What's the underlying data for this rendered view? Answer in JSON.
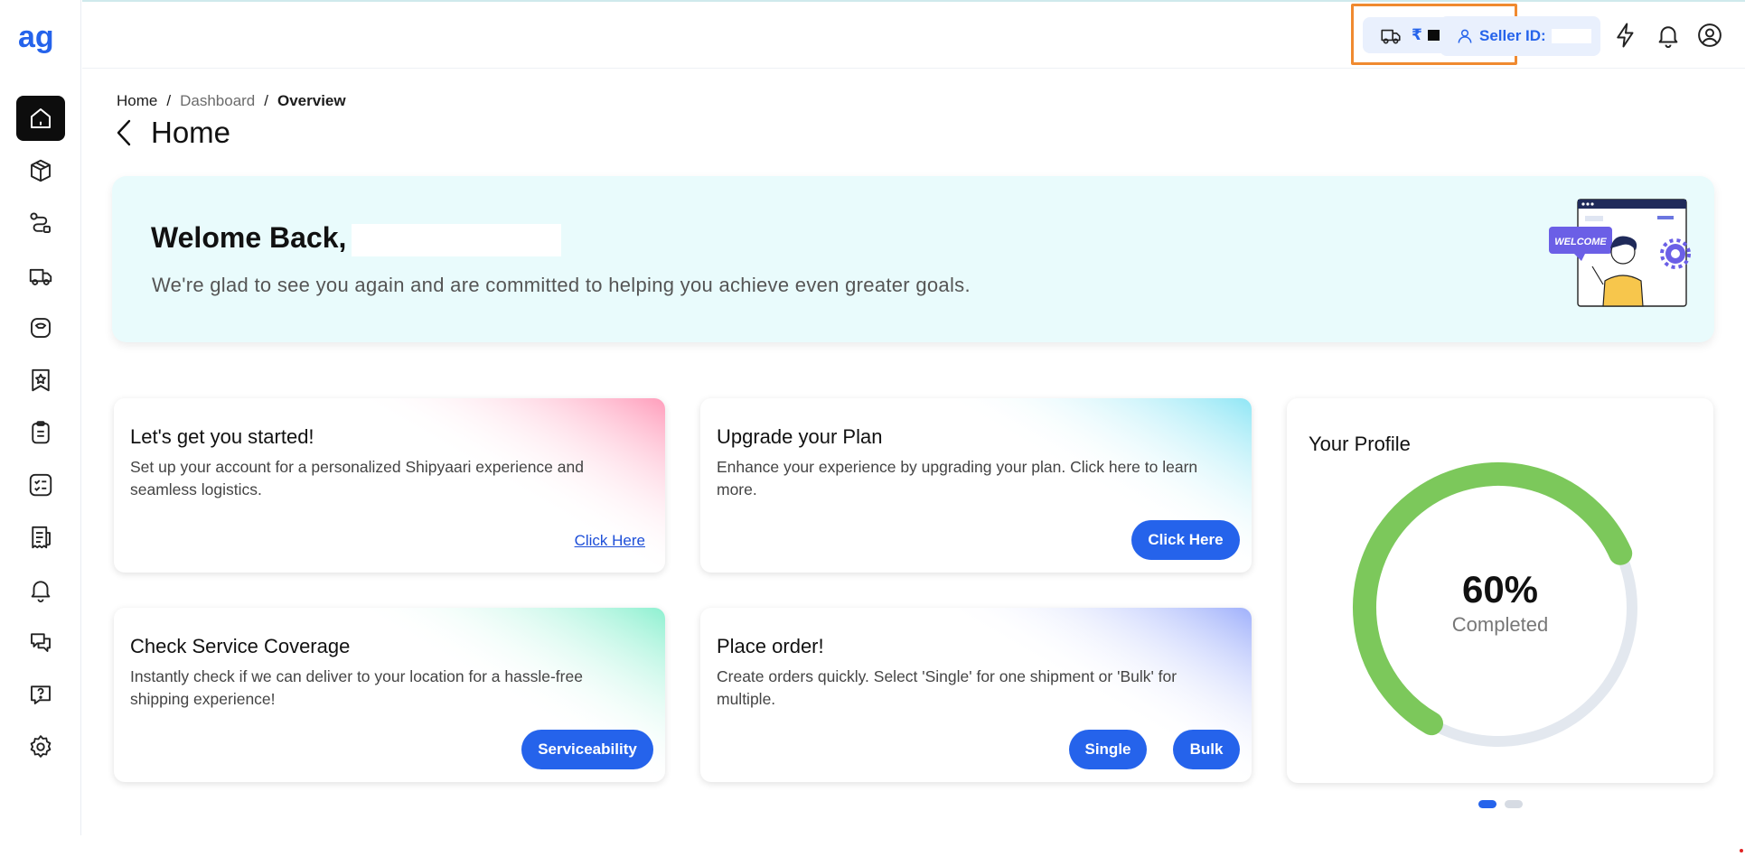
{
  "brand": {
    "logo_text": "ag",
    "logo_color": "#2563eb"
  },
  "sidebar": {
    "items": [
      {
        "icon": "home-icon",
        "active": true
      },
      {
        "icon": "box-icon"
      },
      {
        "icon": "route-icon"
      },
      {
        "icon": "truck-icon"
      },
      {
        "icon": "weight-icon"
      },
      {
        "icon": "badge-star-icon"
      },
      {
        "icon": "clipboard-icon"
      },
      {
        "icon": "checklist-icon"
      },
      {
        "icon": "receipt-icon"
      },
      {
        "icon": "bell-icon"
      },
      {
        "icon": "chat-icon"
      },
      {
        "icon": "help-icon"
      },
      {
        "icon": "gear-icon"
      }
    ]
  },
  "topbar": {
    "wallet_currency": "₹",
    "seller_label": "Seller ID:"
  },
  "breadcrumb": {
    "items": [
      "Home",
      "Dashboard",
      "Overview"
    ],
    "separator": "/"
  },
  "page": {
    "title": "Home"
  },
  "banner": {
    "greeting": "Welome Back,",
    "message": "We're glad to see you again and are committed to helping you achieve even greater goals.",
    "illustration_text": "WELCOME"
  },
  "cards": {
    "get_started": {
      "title": "Let's get you started!",
      "text": "Set up your account for a personalized Shipyaari experience and seamless logistics.",
      "link": "Click Here"
    },
    "upgrade": {
      "title": "Upgrade your Plan",
      "text": "Enhance your experience by upgrading your plan. Click here to learn more.",
      "button": "Click Here"
    },
    "coverage": {
      "title": "Check Service Coverage",
      "text": "Instantly check if we can deliver to your location for a hassle-free shipping experience!",
      "button": "Serviceability"
    },
    "place_order": {
      "title": "Place order!",
      "text": "Create orders quickly. Select 'Single' for one shipment or 'Bulk' for multiple.",
      "button_single": "Single",
      "button_bulk": "Bulk"
    }
  },
  "profile": {
    "title": "Your Profile",
    "percent_text": "60%",
    "progress": 0.6,
    "status": "Completed",
    "colors": {
      "progress": "#7cc85b",
      "track": "#e3e8ef"
    }
  },
  "colors": {
    "accent": "#2563eb",
    "highlight": "#f08a30",
    "banner_bg": "#e9fbfc"
  }
}
